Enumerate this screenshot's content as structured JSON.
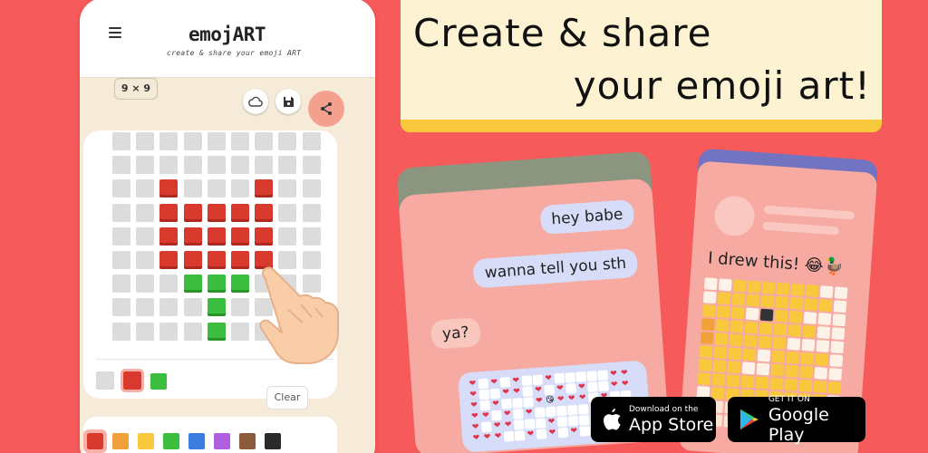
{
  "phone": {
    "app_title": "emojART",
    "app_subtitle": "create & share your emoji ART",
    "grid_size": "9 × 9",
    "clear_label": "Clear"
  },
  "headline": {
    "line1": "Create & share",
    "line2": "your emoji art!"
  },
  "chat": {
    "msg1": "hey babe",
    "msg2": "wanna tell you sth",
    "msg3": "ya?"
  },
  "post": {
    "caption": "I drew this! 😂🦆"
  },
  "badges": {
    "apple_small": "Download on the",
    "apple_big": "App Store",
    "google_small": "GET IT ON",
    "google_big": "Google Play"
  },
  "colors": {
    "background": "#f75a5a",
    "accent_yellow": "#f8c93c",
    "pixel_red": "#d93a2e",
    "pixel_green": "#3bbd3d"
  }
}
